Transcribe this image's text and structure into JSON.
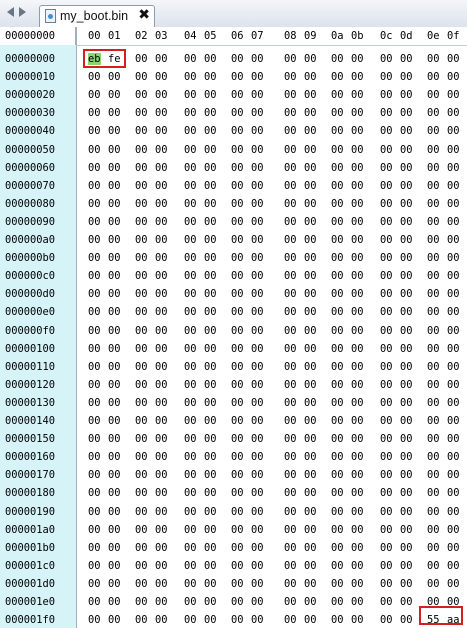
{
  "tab": {
    "filename": "my_boot.bin",
    "close_glyph": "✖"
  },
  "header": {
    "offset_label": "00000000",
    "columns": [
      "00",
      "01",
      "02",
      "03",
      "04",
      "05",
      "06",
      "07",
      "08",
      "09",
      "0a",
      "0b",
      "0c",
      "0d",
      "0e",
      "0f"
    ]
  },
  "rows": [
    {
      "offset": "00000000",
      "bytes": [
        "eb",
        "fe",
        "00",
        "00",
        "00",
        "00",
        "00",
        "00",
        "00",
        "00",
        "00",
        "00",
        "00",
        "00",
        "00",
        "00"
      ]
    },
    {
      "offset": "00000010",
      "bytes": [
        "00",
        "00",
        "00",
        "00",
        "00",
        "00",
        "00",
        "00",
        "00",
        "00",
        "00",
        "00",
        "00",
        "00",
        "00",
        "00"
      ]
    },
    {
      "offset": "00000020",
      "bytes": [
        "00",
        "00",
        "00",
        "00",
        "00",
        "00",
        "00",
        "00",
        "00",
        "00",
        "00",
        "00",
        "00",
        "00",
        "00",
        "00"
      ]
    },
    {
      "offset": "00000030",
      "bytes": [
        "00",
        "00",
        "00",
        "00",
        "00",
        "00",
        "00",
        "00",
        "00",
        "00",
        "00",
        "00",
        "00",
        "00",
        "00",
        "00"
      ]
    },
    {
      "offset": "00000040",
      "bytes": [
        "00",
        "00",
        "00",
        "00",
        "00",
        "00",
        "00",
        "00",
        "00",
        "00",
        "00",
        "00",
        "00",
        "00",
        "00",
        "00"
      ]
    },
    {
      "offset": "00000050",
      "bytes": [
        "00",
        "00",
        "00",
        "00",
        "00",
        "00",
        "00",
        "00",
        "00",
        "00",
        "00",
        "00",
        "00",
        "00",
        "00",
        "00"
      ]
    },
    {
      "offset": "00000060",
      "bytes": [
        "00",
        "00",
        "00",
        "00",
        "00",
        "00",
        "00",
        "00",
        "00",
        "00",
        "00",
        "00",
        "00",
        "00",
        "00",
        "00"
      ]
    },
    {
      "offset": "00000070",
      "bytes": [
        "00",
        "00",
        "00",
        "00",
        "00",
        "00",
        "00",
        "00",
        "00",
        "00",
        "00",
        "00",
        "00",
        "00",
        "00",
        "00"
      ]
    },
    {
      "offset": "00000080",
      "bytes": [
        "00",
        "00",
        "00",
        "00",
        "00",
        "00",
        "00",
        "00",
        "00",
        "00",
        "00",
        "00",
        "00",
        "00",
        "00",
        "00"
      ]
    },
    {
      "offset": "00000090",
      "bytes": [
        "00",
        "00",
        "00",
        "00",
        "00",
        "00",
        "00",
        "00",
        "00",
        "00",
        "00",
        "00",
        "00",
        "00",
        "00",
        "00"
      ]
    },
    {
      "offset": "000000a0",
      "bytes": [
        "00",
        "00",
        "00",
        "00",
        "00",
        "00",
        "00",
        "00",
        "00",
        "00",
        "00",
        "00",
        "00",
        "00",
        "00",
        "00"
      ]
    },
    {
      "offset": "000000b0",
      "bytes": [
        "00",
        "00",
        "00",
        "00",
        "00",
        "00",
        "00",
        "00",
        "00",
        "00",
        "00",
        "00",
        "00",
        "00",
        "00",
        "00"
      ]
    },
    {
      "offset": "000000c0",
      "bytes": [
        "00",
        "00",
        "00",
        "00",
        "00",
        "00",
        "00",
        "00",
        "00",
        "00",
        "00",
        "00",
        "00",
        "00",
        "00",
        "00"
      ]
    },
    {
      "offset": "000000d0",
      "bytes": [
        "00",
        "00",
        "00",
        "00",
        "00",
        "00",
        "00",
        "00",
        "00",
        "00",
        "00",
        "00",
        "00",
        "00",
        "00",
        "00"
      ]
    },
    {
      "offset": "000000e0",
      "bytes": [
        "00",
        "00",
        "00",
        "00",
        "00",
        "00",
        "00",
        "00",
        "00",
        "00",
        "00",
        "00",
        "00",
        "00",
        "00",
        "00"
      ]
    },
    {
      "offset": "000000f0",
      "bytes": [
        "00",
        "00",
        "00",
        "00",
        "00",
        "00",
        "00",
        "00",
        "00",
        "00",
        "00",
        "00",
        "00",
        "00",
        "00",
        "00"
      ]
    },
    {
      "offset": "00000100",
      "bytes": [
        "00",
        "00",
        "00",
        "00",
        "00",
        "00",
        "00",
        "00",
        "00",
        "00",
        "00",
        "00",
        "00",
        "00",
        "00",
        "00"
      ]
    },
    {
      "offset": "00000110",
      "bytes": [
        "00",
        "00",
        "00",
        "00",
        "00",
        "00",
        "00",
        "00",
        "00",
        "00",
        "00",
        "00",
        "00",
        "00",
        "00",
        "00"
      ]
    },
    {
      "offset": "00000120",
      "bytes": [
        "00",
        "00",
        "00",
        "00",
        "00",
        "00",
        "00",
        "00",
        "00",
        "00",
        "00",
        "00",
        "00",
        "00",
        "00",
        "00"
      ]
    },
    {
      "offset": "00000130",
      "bytes": [
        "00",
        "00",
        "00",
        "00",
        "00",
        "00",
        "00",
        "00",
        "00",
        "00",
        "00",
        "00",
        "00",
        "00",
        "00",
        "00"
      ]
    },
    {
      "offset": "00000140",
      "bytes": [
        "00",
        "00",
        "00",
        "00",
        "00",
        "00",
        "00",
        "00",
        "00",
        "00",
        "00",
        "00",
        "00",
        "00",
        "00",
        "00"
      ]
    },
    {
      "offset": "00000150",
      "bytes": [
        "00",
        "00",
        "00",
        "00",
        "00",
        "00",
        "00",
        "00",
        "00",
        "00",
        "00",
        "00",
        "00",
        "00",
        "00",
        "00"
      ]
    },
    {
      "offset": "00000160",
      "bytes": [
        "00",
        "00",
        "00",
        "00",
        "00",
        "00",
        "00",
        "00",
        "00",
        "00",
        "00",
        "00",
        "00",
        "00",
        "00",
        "00"
      ]
    },
    {
      "offset": "00000170",
      "bytes": [
        "00",
        "00",
        "00",
        "00",
        "00",
        "00",
        "00",
        "00",
        "00",
        "00",
        "00",
        "00",
        "00",
        "00",
        "00",
        "00"
      ]
    },
    {
      "offset": "00000180",
      "bytes": [
        "00",
        "00",
        "00",
        "00",
        "00",
        "00",
        "00",
        "00",
        "00",
        "00",
        "00",
        "00",
        "00",
        "00",
        "00",
        "00"
      ]
    },
    {
      "offset": "00000190",
      "bytes": [
        "00",
        "00",
        "00",
        "00",
        "00",
        "00",
        "00",
        "00",
        "00",
        "00",
        "00",
        "00",
        "00",
        "00",
        "00",
        "00"
      ]
    },
    {
      "offset": "000001a0",
      "bytes": [
        "00",
        "00",
        "00",
        "00",
        "00",
        "00",
        "00",
        "00",
        "00",
        "00",
        "00",
        "00",
        "00",
        "00",
        "00",
        "00"
      ]
    },
    {
      "offset": "000001b0",
      "bytes": [
        "00",
        "00",
        "00",
        "00",
        "00",
        "00",
        "00",
        "00",
        "00",
        "00",
        "00",
        "00",
        "00",
        "00",
        "00",
        "00"
      ]
    },
    {
      "offset": "000001c0",
      "bytes": [
        "00",
        "00",
        "00",
        "00",
        "00",
        "00",
        "00",
        "00",
        "00",
        "00",
        "00",
        "00",
        "00",
        "00",
        "00",
        "00"
      ]
    },
    {
      "offset": "000001d0",
      "bytes": [
        "00",
        "00",
        "00",
        "00",
        "00",
        "00",
        "00",
        "00",
        "00",
        "00",
        "00",
        "00",
        "00",
        "00",
        "00",
        "00"
      ]
    },
    {
      "offset": "000001e0",
      "bytes": [
        "00",
        "00",
        "00",
        "00",
        "00",
        "00",
        "00",
        "00",
        "00",
        "00",
        "00",
        "00",
        "00",
        "00",
        "00",
        "00"
      ]
    },
    {
      "offset": "000001f0",
      "bytes": [
        "00",
        "00",
        "00",
        "00",
        "00",
        "00",
        "00",
        "00",
        "00",
        "00",
        "00",
        "00",
        "00",
        "00",
        "55",
        "aa"
      ]
    }
  ],
  "colors": {
    "gutter": "#d6f4f8",
    "selection": "#8ed46e",
    "highlight_box": "#d31f1f"
  },
  "icons": {
    "nav_back": "triangle-left-icon",
    "nav_forward": "triangle-right-icon",
    "file": "binary-file-icon"
  }
}
